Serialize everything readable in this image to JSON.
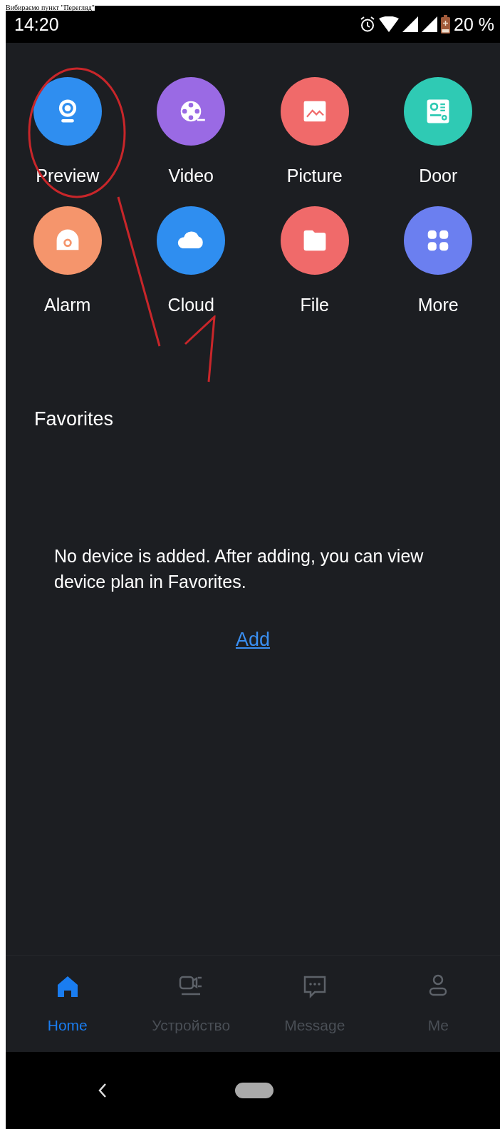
{
  "caption": "Вибираємо пункт \"Перегляд\"",
  "status_bar": {
    "time": "14:20",
    "battery": "20 %"
  },
  "shortcuts": [
    {
      "kind": "camera",
      "label": "Preview",
      "color": "#2f8ef0"
    },
    {
      "kind": "film",
      "label": "Video",
      "color": "#9a6ae4"
    },
    {
      "kind": "image",
      "label": "Picture",
      "color": "#f06a6a"
    },
    {
      "kind": "intercom",
      "label": "Door",
      "color": "#2fcab4"
    },
    {
      "kind": "alarm",
      "label": "Alarm",
      "color": "#f5956c"
    },
    {
      "kind": "cloud",
      "label": "Cloud",
      "color": "#2f8ef0"
    },
    {
      "kind": "folder",
      "label": "File",
      "color": "#f06a6a"
    },
    {
      "kind": "grid",
      "label": "More",
      "color": "#6b7ff0"
    }
  ],
  "favorites": {
    "title": "Favorites",
    "empty_message": "No device is added. After adding, you can view device plan in Favorites.",
    "add_link": "Add"
  },
  "tabs": [
    {
      "kind": "home",
      "label": "Home",
      "selected": true
    },
    {
      "kind": "device",
      "label": "Устройство",
      "selected": false
    },
    {
      "kind": "message",
      "label": "Message",
      "selected": false
    },
    {
      "kind": "me",
      "label": "Me",
      "selected": false
    }
  ]
}
